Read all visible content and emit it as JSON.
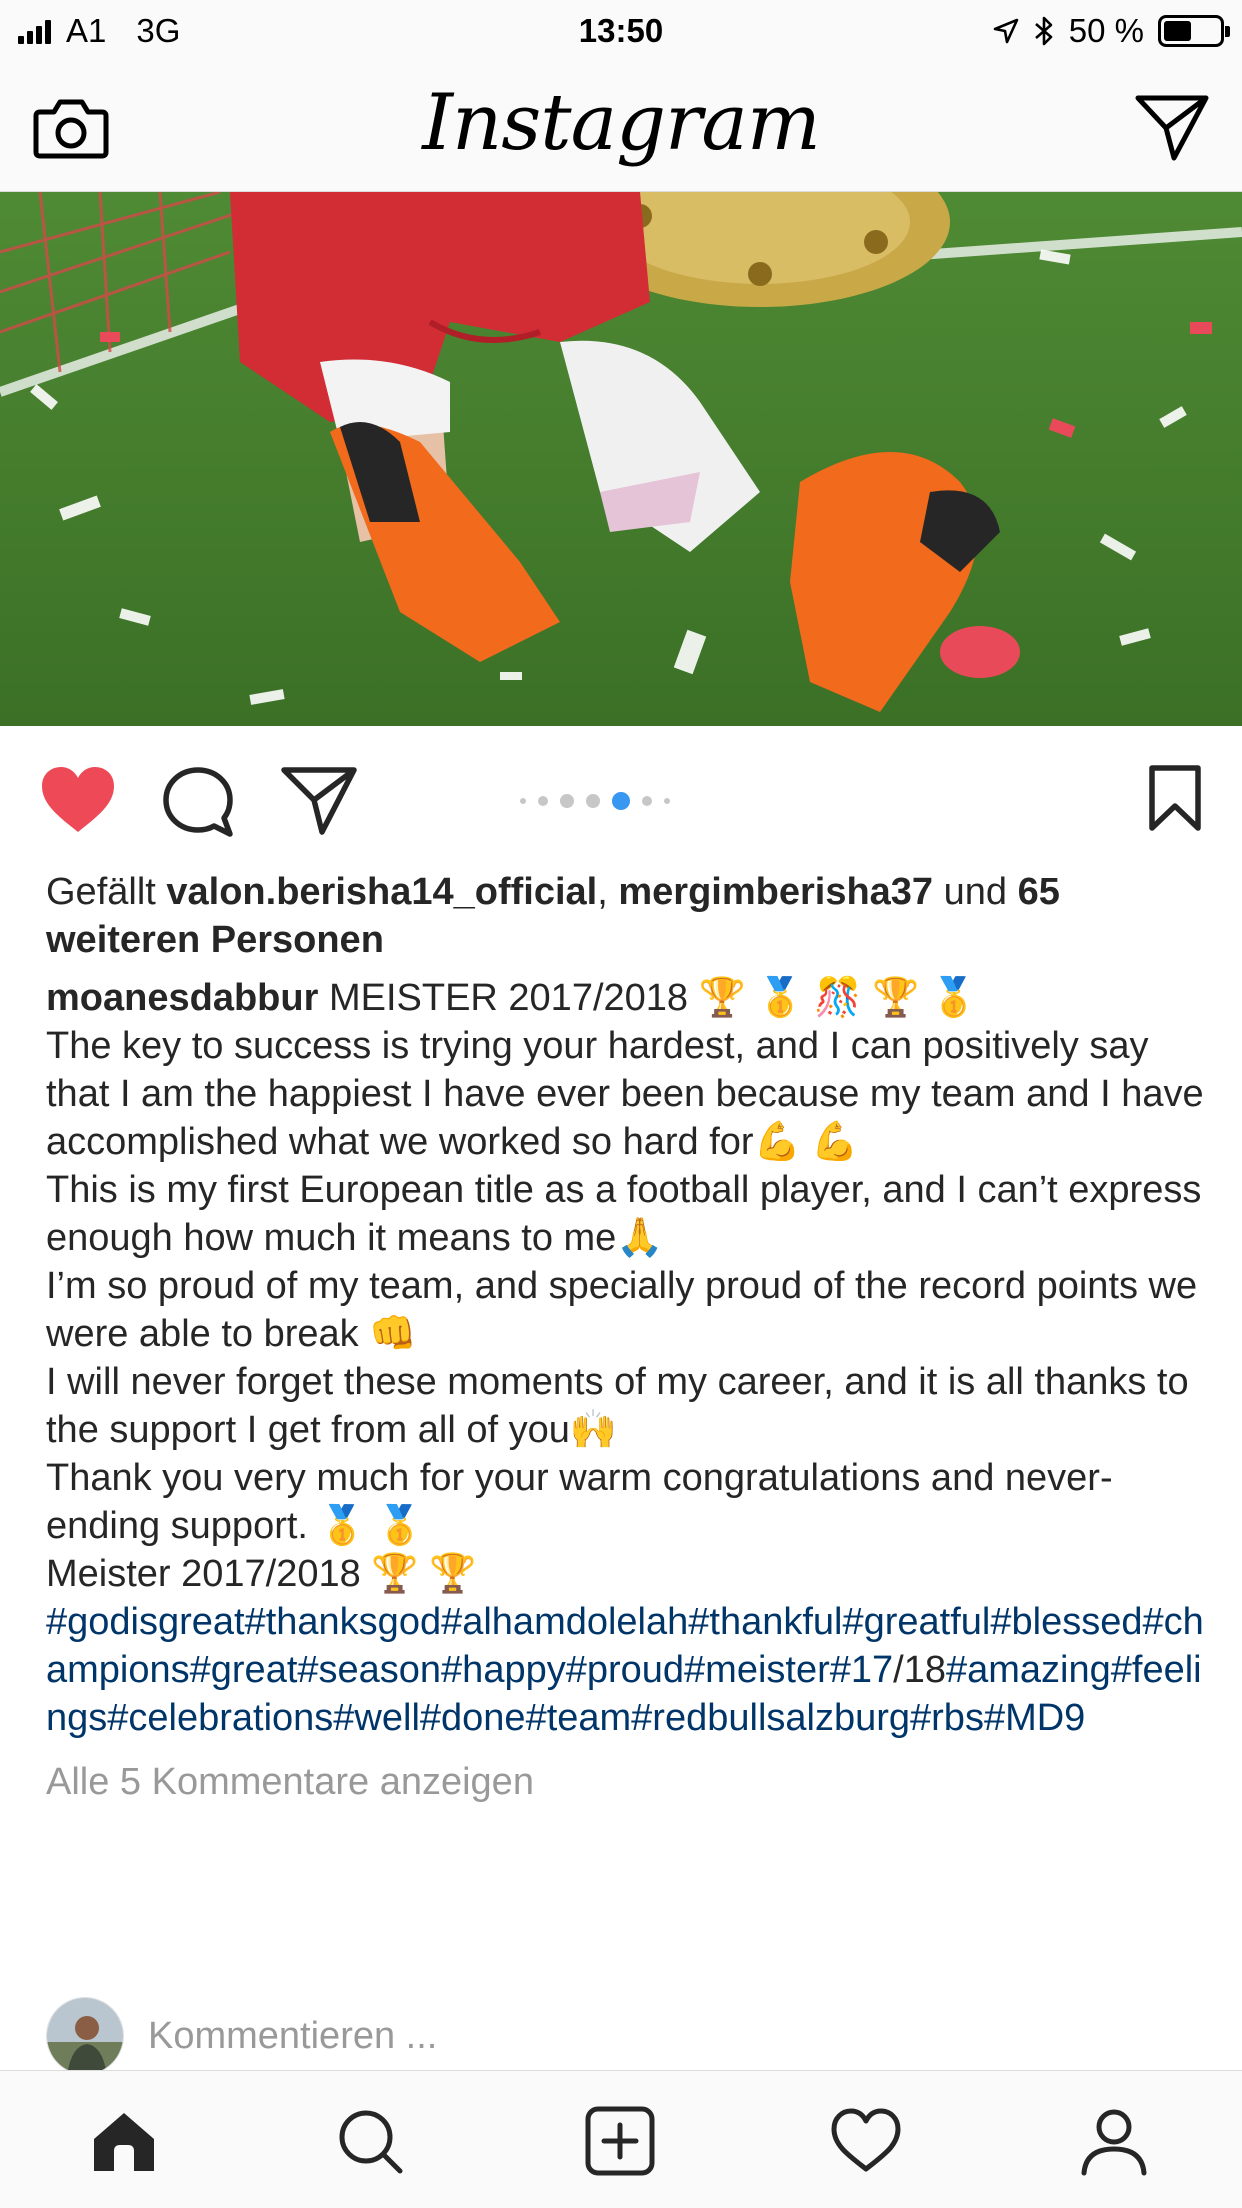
{
  "status_bar": {
    "carrier": "A1",
    "network": "3G",
    "time": "13:50",
    "battery": "50 %",
    "battery_level_fraction": 0.5
  },
  "header": {
    "logo": "Instagram",
    "left_icon": "camera-icon",
    "right_icon": "direct-message-icon"
  },
  "post": {
    "image_icon": "post-photo",
    "carousel": {
      "count": 7,
      "active_index": 4
    },
    "actions": {
      "like_icon": "heart-filled-icon",
      "comment_icon": "comment-icon",
      "share_icon": "share-icon",
      "save_icon": "bookmark-icon"
    },
    "likes": {
      "prefix": "Gefällt",
      "user1": "valon.berisha14_official",
      "separator": ",",
      "user2": "mergimberisha37",
      "conjunction": "und",
      "others": "65 weiteren Personen"
    },
    "caption": {
      "username": "moanesdabbur",
      "line1": "MEISTER 2017/2018 🏆 🥇 🎊 🏆 🥇",
      "line2": "The key to success is trying your hardest, and I can positively say that I am the happiest I have ever been because my team and I have accomplished what we worked so hard for💪 💪",
      "line3": "This is my first European title as a football player, and I can’t express enough how much it means to me🙏",
      "line4": "I’m so proud of my team, and specially proud of the record points we were able to break 👊",
      "line5": "I will never forget these moments of my career, and it is all thanks to the support I get from all of you🙌",
      "line6": "Thank you very much for your warm congratulations and never-ending support. 🥇 🥇",
      "line7": "Meister 2017/2018 🏆 🏆",
      "hashtags_a": "#godisgreat#thanksgod#alhamdolelah#thankful#greatful#blessed#champions#great#season#happy#proud#meister#17",
      "hashtags_mid": "/18",
      "hashtags_b": "#amazing#feelings#celebrations#well#done#team#redbullsalzburg#rbs#MD9"
    },
    "view_comments": "Alle 5 Kommentare anzeigen",
    "comment_placeholder": "Kommentieren ..."
  },
  "tab_bar": {
    "items": [
      "home-icon",
      "search-icon",
      "add-post-icon",
      "activity-heart-icon",
      "profile-icon"
    ],
    "active": "home-icon"
  },
  "colors": {
    "like_red": "#ed4956",
    "hashtag_blue": "#003569",
    "carousel_active": "#3897f0",
    "muted_text": "#999999"
  }
}
